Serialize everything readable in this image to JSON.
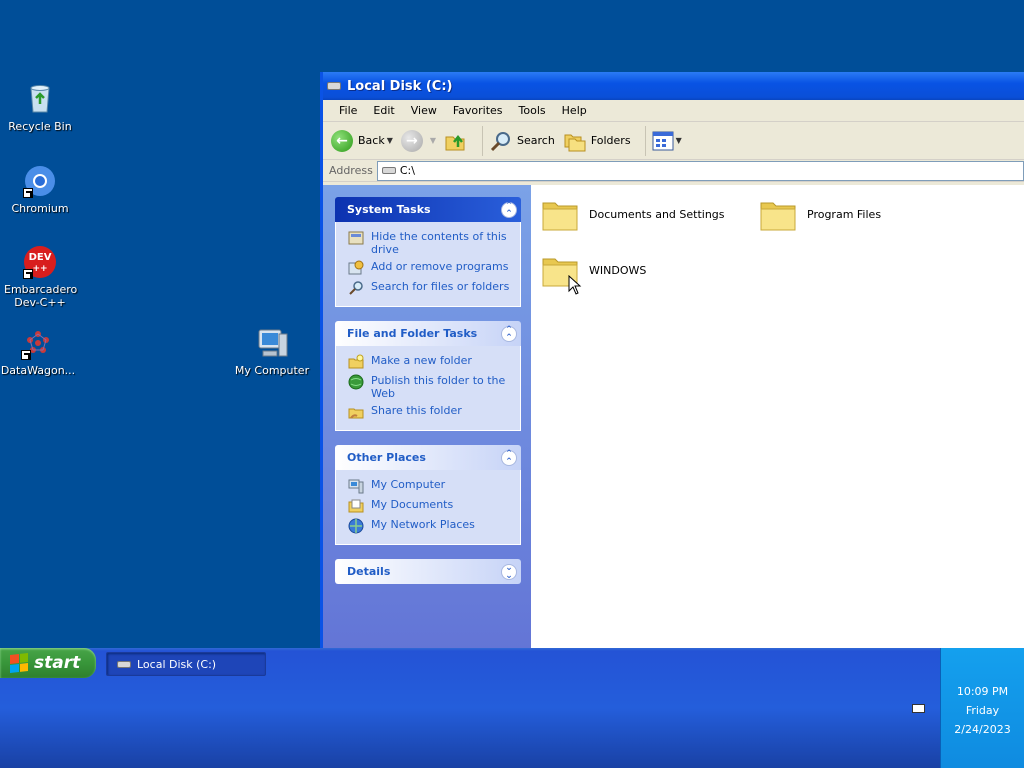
{
  "desktop": {
    "icons": [
      {
        "label": "Recycle Bin"
      },
      {
        "label": "Chromium"
      },
      {
        "label": "Embarcadero Dev-C++"
      },
      {
        "label": "DataWagon..."
      },
      {
        "label": "My Computer"
      }
    ]
  },
  "window": {
    "title": "Local Disk (C:)",
    "menu": [
      "File",
      "Edit",
      "View",
      "Favorites",
      "Tools",
      "Help"
    ],
    "toolbar": {
      "back": "Back",
      "search": "Search",
      "folders": "Folders"
    },
    "address": {
      "label": "Address",
      "value": "C:\\"
    },
    "taskpane": {
      "system_tasks": {
        "title": "System Tasks",
        "items": [
          "Hide the contents of this drive",
          "Add or remove programs",
          "Search for files or folders"
        ]
      },
      "file_folder_tasks": {
        "title": "File and Folder Tasks",
        "items": [
          "Make a new folder",
          "Publish this folder to the Web",
          "Share this folder"
        ]
      },
      "other_places": {
        "title": "Other Places",
        "items": [
          "My Computer",
          "My Documents",
          "My Network Places"
        ]
      },
      "details": {
        "title": "Details"
      }
    },
    "files": [
      "Documents and Settings",
      "Program Files",
      "WINDOWS"
    ]
  },
  "taskbar": {
    "start_label": "start",
    "task_button": "Local Disk (C:)",
    "clock": {
      "time": "10:09 PM",
      "day": "Friday",
      "date": "2/24/2023"
    }
  },
  "colors": {
    "desktop": "#004e98",
    "taskbar": "#245edb",
    "titlebar": "#0953e4",
    "link": "#215dc6"
  }
}
